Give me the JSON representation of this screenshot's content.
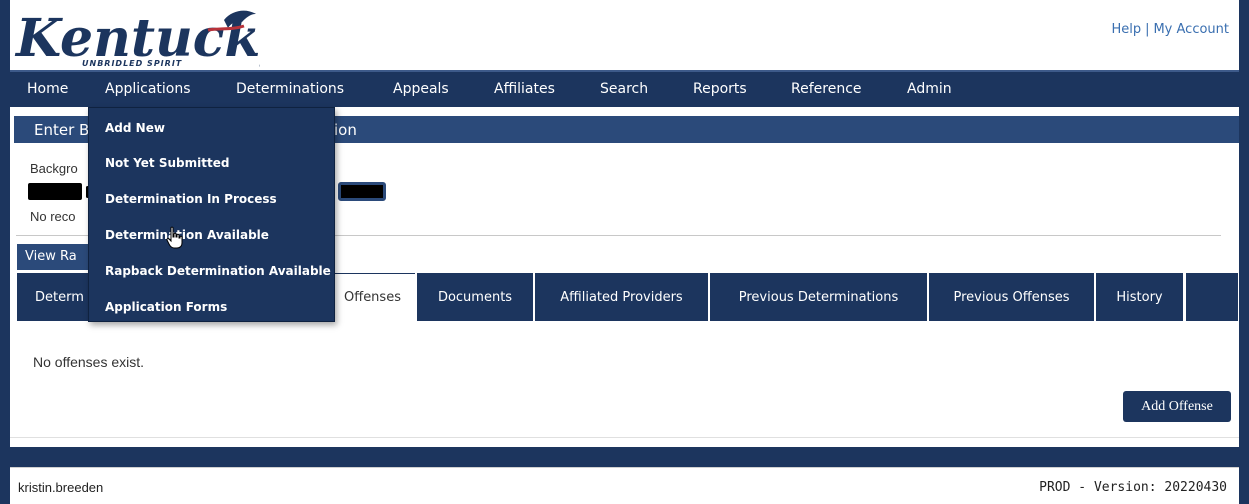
{
  "header": {
    "logo_text": "Kentucky",
    "logo_tagline": "UNBRIDLED SPIRIT",
    "help_label": "Help",
    "separator": "|",
    "account_label": "My Account"
  },
  "nav": {
    "items": [
      {
        "label": "Home"
      },
      {
        "label": "Applications"
      },
      {
        "label": "Determinations"
      },
      {
        "label": "Appeals"
      },
      {
        "label": "Affiliates"
      },
      {
        "label": "Search"
      },
      {
        "label": "Reports"
      },
      {
        "label": "Reference"
      },
      {
        "label": "Admin"
      }
    ]
  },
  "applications_menu": {
    "items": [
      {
        "label": "Add New"
      },
      {
        "label": "Not Yet Submitted"
      },
      {
        "label": "Determination In Process"
      },
      {
        "label": "Determination Available"
      },
      {
        "label": "Rapback Determination Available"
      },
      {
        "label": "Application Forms"
      }
    ]
  },
  "section": {
    "title_left": "Enter B",
    "title_right": "ion"
  },
  "content": {
    "background_label": "Backgro",
    "record_text": "No reco",
    "view_button": "View Ra"
  },
  "tabs": {
    "items": [
      {
        "label": "Determ"
      },
      {
        "label": "Offenses"
      },
      {
        "label": "Documents"
      },
      {
        "label": "Affiliated Providers"
      },
      {
        "label": "Previous Determinations"
      },
      {
        "label": "Previous Offenses"
      },
      {
        "label": "History"
      },
      {
        "label": ""
      }
    ],
    "active": "Offenses"
  },
  "offenses": {
    "empty_message": "No offenses exist.",
    "add_button": "Add Offense"
  },
  "footer": {
    "username": "kristin.breeden",
    "version": "PROD - Version: 20220430"
  },
  "colors": {
    "nav_bg": "#1c355e",
    "section_bg": "#2b4a7a",
    "link": "#3a6fb0"
  }
}
